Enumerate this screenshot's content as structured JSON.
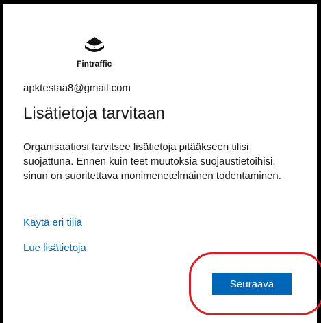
{
  "brand": {
    "name": "Fintraffic",
    "logo_icon": "fintraffic-logo-icon"
  },
  "account": {
    "email": "apktestaa8@gmail.com"
  },
  "heading": "Lisätietoja tarvitaan",
  "message": "Organisaatiosi tarvitsee lisätietoja pitääkseen tilisi suojattuna. Ennen kuin teet muutoksia suojaustietoihisi, sinun on suoritettava monimenetelmäinen todentaminen.",
  "links": {
    "use_other_account": "Käytä eri tiliä",
    "learn_more": "Lue lisätietoja"
  },
  "actions": {
    "next_label": "Seuraava"
  },
  "colors": {
    "accent": "#0067b8",
    "annotation": "#d61f26",
    "text": "#1b1b1b"
  }
}
